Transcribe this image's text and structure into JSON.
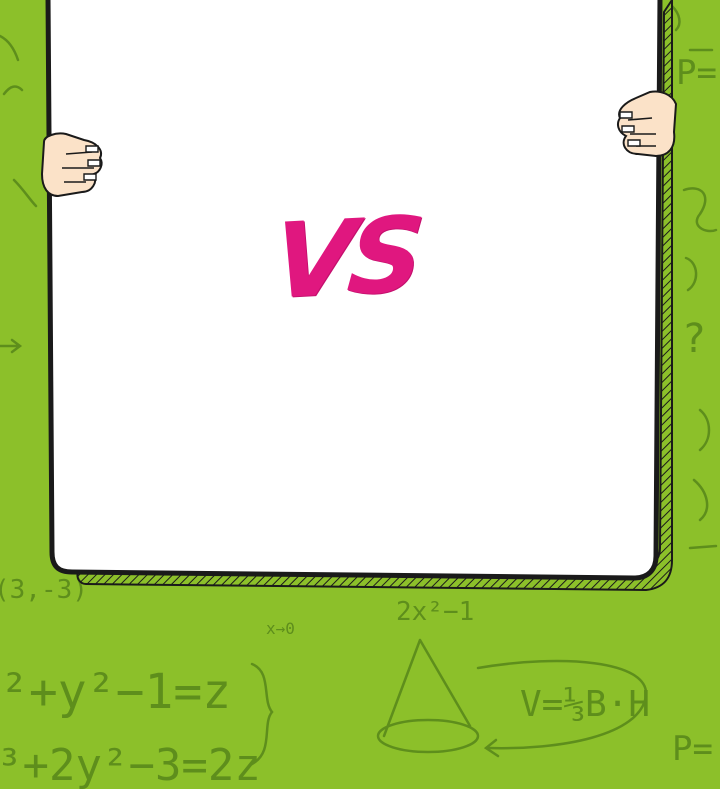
{
  "board": {
    "label": "VS"
  },
  "colors": {
    "background": "#8cc02a",
    "board": "#ffffff",
    "outline": "#1a1a1a",
    "accent": "#e0177f",
    "scribble": "#5e8e1c",
    "skin": "#fbe2c8"
  },
  "doodles": {
    "equation_1": "²+y²−1=z",
    "equation_2": "³+2y²−3=2z",
    "equation_3": "2x²−1",
    "equation_4": "V=⅓B·H",
    "limit_label": "x→0",
    "point_label": "(3,-3)",
    "pressure_label": "P=",
    "pressure_label_2": "P=",
    "question_mark": "?"
  }
}
